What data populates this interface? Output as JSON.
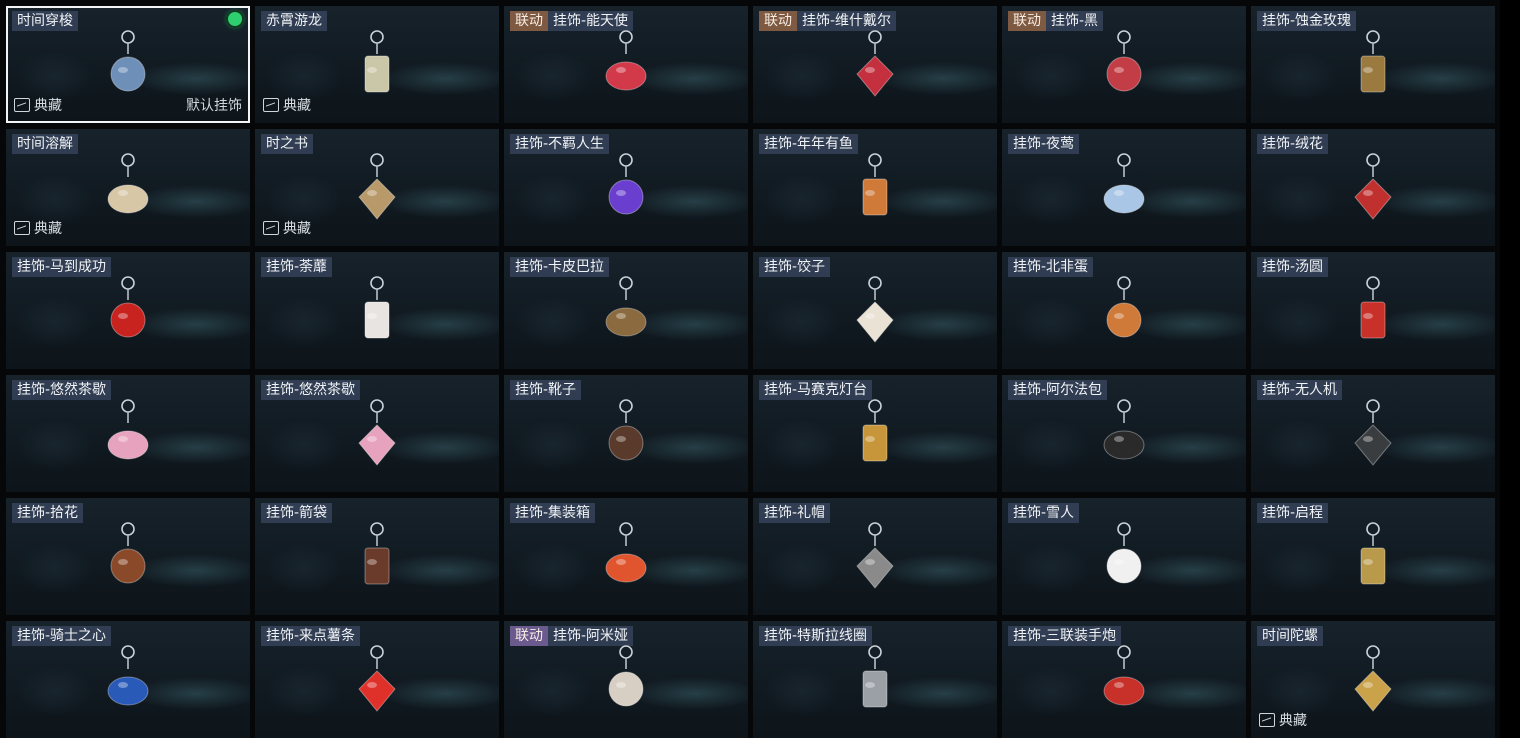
{
  "grid": {
    "columns": 6,
    "selected_index": 0,
    "equipped_color": "#2ecf6e",
    "cards": [
      {
        "name": "时间穿梭",
        "collab": "",
        "collection": "典藏",
        "default": "默认挂饰",
        "charm": "time-shuttle-charm-icon",
        "color": "#6e8fb8"
      },
      {
        "name": "赤霄游龙",
        "collab": "",
        "collection": "典藏",
        "default": "",
        "charm": "crimson-dragon-charm-icon",
        "color": "#c9c7a8"
      },
      {
        "name": "挂饰-能天使",
        "collab": "联动",
        "collection": "",
        "default": "",
        "charm": "exusiai-charm-icon",
        "color": "#d23a4a"
      },
      {
        "name": "挂饰-维什戴尔",
        "collab": "联动",
        "collection": "",
        "default": "",
        "charm": "wisadel-charm-icon",
        "color": "#c5303f"
      },
      {
        "name": "挂饰-黑",
        "collab": "联动",
        "collection": "",
        "default": "",
        "charm": "schwarz-charm-icon",
        "color": "#c33d46"
      },
      {
        "name": "挂饰-蚀金玫瑰",
        "collab": "",
        "collection": "",
        "default": "",
        "charm": "gold-rose-charm-icon",
        "color": "#9a7a3e"
      },
      {
        "name": "时间溶解",
        "collab": "",
        "collection": "典藏",
        "default": "",
        "charm": "time-dissolve-charm-icon",
        "color": "#d7c7a7"
      },
      {
        "name": "时之书",
        "collab": "",
        "collection": "典藏",
        "default": "",
        "charm": "book-of-time-charm-icon",
        "color": "#b89a6a"
      },
      {
        "name": "挂饰-不羁人生",
        "collab": "",
        "collection": "",
        "default": "",
        "charm": "sneaker-charm-icon",
        "color": "#6a3fd0"
      },
      {
        "name": "挂饰-年年有鱼",
        "collab": "",
        "collection": "",
        "default": "",
        "charm": "fish-plate-charm-icon",
        "color": "#d07a3a"
      },
      {
        "name": "挂饰-夜莺",
        "collab": "",
        "collection": "",
        "default": "",
        "charm": "feather-charm-icon",
        "color": "#a9c6e6"
      },
      {
        "name": "挂饰-绒花",
        "collab": "",
        "collection": "",
        "default": "",
        "charm": "velvet-flower-charm-icon",
        "color": "#c0302e"
      },
      {
        "name": "挂饰-马到成功",
        "collab": "",
        "collection": "",
        "default": "",
        "charm": "red-horse-charm-icon",
        "color": "#c8231f"
      },
      {
        "name": "挂饰-荼蘼",
        "collab": "",
        "collection": "",
        "default": "",
        "charm": "white-flower-charm-icon",
        "color": "#e8e4e2"
      },
      {
        "name": "挂饰-卡皮巴拉",
        "collab": "",
        "collection": "",
        "default": "",
        "charm": "capybara-charm-icon",
        "color": "#8a6a3e"
      },
      {
        "name": "挂饰-饺子",
        "collab": "",
        "collection": "",
        "default": "",
        "charm": "dumpling-plate-charm-icon",
        "color": "#e9e2d5"
      },
      {
        "name": "挂饰-北非蛋",
        "collab": "",
        "collection": "",
        "default": "",
        "charm": "shakshuka-charm-icon",
        "color": "#d07a3a"
      },
      {
        "name": "挂饰-汤圆",
        "collab": "",
        "collection": "",
        "default": "",
        "charm": "tangyuan-bowl-charm-icon",
        "color": "#c8302a"
      },
      {
        "name": "挂饰-悠然茶歇",
        "collab": "",
        "collection": "",
        "default": "",
        "charm": "cupcake-charm-icon",
        "color": "#e7a3bd"
      },
      {
        "name": "挂饰-悠然茶歇",
        "collab": "",
        "collection": "",
        "default": "",
        "charm": "cupcake-charm-icon",
        "color": "#e7a3bd"
      },
      {
        "name": "挂饰-靴子",
        "collab": "",
        "collection": "",
        "default": "",
        "charm": "boot-charm-icon",
        "color": "#5a3a2a"
      },
      {
        "name": "挂饰-马赛克灯台",
        "collab": "",
        "collection": "",
        "default": "",
        "charm": "mosaic-lamp-charm-icon",
        "color": "#c8963a"
      },
      {
        "name": "挂饰-阿尔法包",
        "collab": "",
        "collection": "",
        "default": "",
        "charm": "alpha-bag-charm-icon",
        "color": "#2a2a2a"
      },
      {
        "name": "挂饰-无人机",
        "collab": "",
        "collection": "",
        "default": "",
        "charm": "drone-charm-icon",
        "color": "#3a3d40"
      },
      {
        "name": "挂饰-拾花",
        "collab": "",
        "collection": "",
        "default": "",
        "charm": "picture-frame-charm-icon",
        "color": "#8a4a2a"
      },
      {
        "name": "挂饰-箭袋",
        "collab": "",
        "collection": "",
        "default": "",
        "charm": "quiver-charm-icon",
        "color": "#6a3a2a"
      },
      {
        "name": "挂饰-集装箱",
        "collab": "",
        "collection": "",
        "default": "",
        "charm": "container-charm-icon",
        "color": "#e0552e"
      },
      {
        "name": "挂饰-礼帽",
        "collab": "",
        "collection": "",
        "default": "",
        "charm": "top-hat-charm-icon",
        "color": "#8a8a8a"
      },
      {
        "name": "挂饰-雪人",
        "collab": "",
        "collection": "",
        "default": "",
        "charm": "snowman-charm-icon",
        "color": "#f0f0f0"
      },
      {
        "name": "挂饰-启程",
        "collab": "",
        "collection": "",
        "default": "",
        "charm": "compass-medal-charm-icon",
        "color": "#b89a4a"
      },
      {
        "name": "挂饰-骑士之心",
        "collab": "",
        "collection": "",
        "default": "",
        "charm": "knight-heart-charm-icon",
        "color": "#2a5ab8"
      },
      {
        "name": "挂饰-来点薯条",
        "collab": "",
        "collection": "",
        "default": "",
        "charm": "fries-charm-icon",
        "color": "#e0302a"
      },
      {
        "name": "挂饰-阿米娅",
        "collab": "联动",
        "collab_style": "purple",
        "collection": "",
        "default": "",
        "charm": "amiya-charm-icon",
        "color": "#d8cfc4"
      },
      {
        "name": "挂饰-特斯拉线圈",
        "collab": "",
        "collection": "",
        "default": "",
        "charm": "tesla-coil-charm-icon",
        "color": "#9aa0a6"
      },
      {
        "name": "挂饰-三联装手炮",
        "collab": "",
        "collection": "",
        "default": "",
        "charm": "triple-cannon-charm-icon",
        "color": "#c8302a"
      },
      {
        "name": "时间陀螺",
        "collab": "",
        "collection": "典藏",
        "default": "",
        "charm": "time-top-charm-icon",
        "color": "#c9a24a"
      }
    ]
  }
}
